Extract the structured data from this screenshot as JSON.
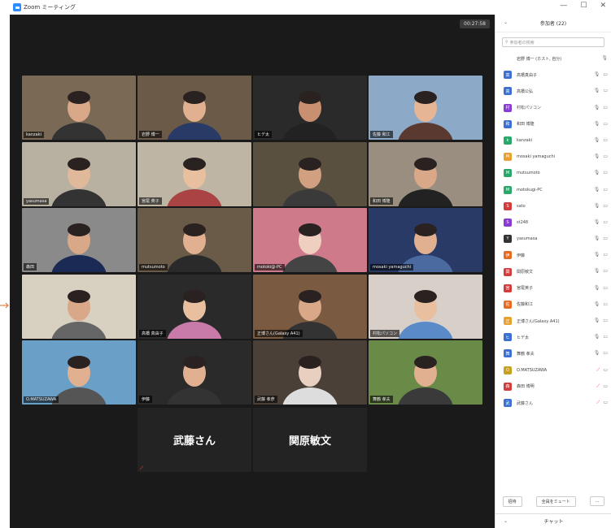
{
  "window": {
    "title": "Zoom ミーティング",
    "minimize": "—",
    "maximize": "☐",
    "close": "✕"
  },
  "meeting": {
    "timer": "00:27:58"
  },
  "tiles": [
    {
      "name": "kanzaki",
      "bg": "#7a6a55",
      "skin": "#d9a888",
      "shirt": "#333",
      "active": false
    },
    {
      "name": "岩野 博一",
      "bg": "#6b5a48",
      "skin": "#e0b090",
      "shirt": "#2a3a66",
      "active": true
    },
    {
      "name": "ヒデ太",
      "bg": "#2a2a2a",
      "skin": "#c89070",
      "shirt": "#222",
      "active": false
    },
    {
      "name": "佐藤 和江",
      "bg": "#8da9c8",
      "skin": "#e6b596",
      "shirt": "#5a3a30",
      "active": false
    },
    {
      "name": "yasumasa",
      "bg": "#b8b0a0",
      "skin": "#e0b89a",
      "shirt": "#333",
      "active": false
    },
    {
      "name": "宮尾 英子",
      "bg": "#bfb5a5",
      "skin": "#e8c0a0",
      "shirt": "#a44",
      "active": false
    },
    {
      "name": "",
      "bg": "#5a5040",
      "skin": "#d0a080",
      "shirt": "#3a3a3a",
      "active": false
    },
    {
      "name": "和田 博隆",
      "bg": "#9a8e80",
      "skin": "#d8a888",
      "shirt": "#222",
      "active": false
    },
    {
      "name": "森田",
      "bg": "#8a8a8a",
      "skin": "#d8a888",
      "shirt": "#1a2a55",
      "active": false
    },
    {
      "name": "mutsumoto",
      "bg": "#6a5a48",
      "skin": "#e0b090",
      "shirt": "#2a2a2a",
      "active": false
    },
    {
      "name": "motoki@-PC",
      "bg": "#cf7a8a",
      "skin": "#efd0c0",
      "shirt": "#444",
      "active": false
    },
    {
      "name": "mosaki yamaguchi",
      "bg": "#2a3a66",
      "skin": "#e0b090",
      "shirt": "#4a6aa0",
      "active": false
    },
    {
      "name": "",
      "bg": "#d8d0c0",
      "skin": "#d8a888",
      "shirt": "#666",
      "active": false
    },
    {
      "name": "高橋 真由子",
      "bg": "#2a2a2a",
      "skin": "#e8c0a0",
      "shirt": "#c87aa8",
      "active": false
    },
    {
      "name": "正博さん(Galaxy A41)",
      "bg": "#7a5a40",
      "skin": "#d8a888",
      "shirt": "#333",
      "active": false
    },
    {
      "name": "村松パソコン",
      "bg": "#d8d0c8",
      "skin": "#e8c0a0",
      "shirt": "#5a8ac8",
      "active": false
    },
    {
      "name": "O.MATSUZAWA",
      "bg": "#6aa0c8",
      "skin": "#e0b090",
      "shirt": "#555",
      "active": false
    },
    {
      "name": "伊藤",
      "bg": "#2a2a2a",
      "skin": "#e0b090",
      "shirt": "#333",
      "active": false
    },
    {
      "name": "武藤 孝彦",
      "bg": "#4a4038",
      "skin": "#e8d0c0",
      "shirt": "#ddd",
      "active": false
    },
    {
      "name": "舞鶴 孝夫",
      "bg": "#6a8a48",
      "skin": "#e0b090",
      "shirt": "#3a3a3a",
      "active": false
    }
  ],
  "name_tiles": [
    "武藤さん",
    "関原敏文"
  ],
  "participants_panel": {
    "title": "参加者 (22)",
    "search_placeholder": "参加者の検索",
    "self": "岩野 博一 (ホスト, 自分)",
    "list": [
      {
        "initial": "高",
        "name": "高橋真由子",
        "color": "#3b6fd4",
        "muted": false
      },
      {
        "initial": "高",
        "name": "高橋公弘",
        "color": "#3b6fd4",
        "muted": false
      },
      {
        "initial": "村",
        "name": "村松パソコン",
        "color": "#8a3bd4",
        "muted": false
      },
      {
        "initial": "和",
        "name": "和田 博隆",
        "color": "#3b6fd4",
        "muted": false
      },
      {
        "initial": "k",
        "name": "kanzaki",
        "color": "#2aa86a",
        "muted": false
      },
      {
        "initial": "M",
        "name": "mosaki yamaguchi",
        "color": "#e8a030",
        "muted": false
      },
      {
        "initial": "M",
        "name": "mutsumoto",
        "color": "#2aa86a",
        "muted": false
      },
      {
        "initial": "M",
        "name": "motokugi-PC",
        "color": "#2aa86a",
        "muted": false
      },
      {
        "initial": "S",
        "name": "sato",
        "color": "#d43b3b",
        "muted": false
      },
      {
        "initial": "S",
        "name": "st248",
        "color": "#8a3bd4",
        "muted": false
      },
      {
        "initial": "Y",
        "name": "yasumasa",
        "color": "#333333",
        "muted": false
      },
      {
        "initial": "伊",
        "name": "伊藤",
        "color": "#e86a20",
        "muted": false
      },
      {
        "initial": "関",
        "name": "関原敏文",
        "color": "#d43b3b",
        "muted": false
      },
      {
        "initial": "宮",
        "name": "宮尾英子",
        "color": "#d43b3b",
        "muted": false
      },
      {
        "initial": "佐",
        "name": "佐藤和江",
        "color": "#e86a20",
        "muted": false
      },
      {
        "initial": "正",
        "name": "正博さん(Galaxy A41)",
        "color": "#e8a030",
        "muted": false
      },
      {
        "initial": "ヒ",
        "name": "ヒデ太",
        "color": "#3b6fd4",
        "muted": false
      },
      {
        "initial": "舞",
        "name": "舞鶴 孝夫",
        "color": "#3b6fd4",
        "muted": false
      },
      {
        "initial": "O",
        "name": "O.MATSUZAWA",
        "color": "#c8a020",
        "muted": true
      },
      {
        "initial": "森",
        "name": "森田 博明",
        "color": "#d43b3b",
        "muted": true
      },
      {
        "initial": "武",
        "name": "武藤さん",
        "color": "#3b6fd4",
        "muted": true
      }
    ],
    "invite": "招待",
    "mute_all": "全員をミュート",
    "more": "...",
    "chat": "チャット"
  },
  "colors": {
    "active_speaker": "#b5d233",
    "zoom_blue": "#2d8cff",
    "muted_red": "#e8382b"
  }
}
